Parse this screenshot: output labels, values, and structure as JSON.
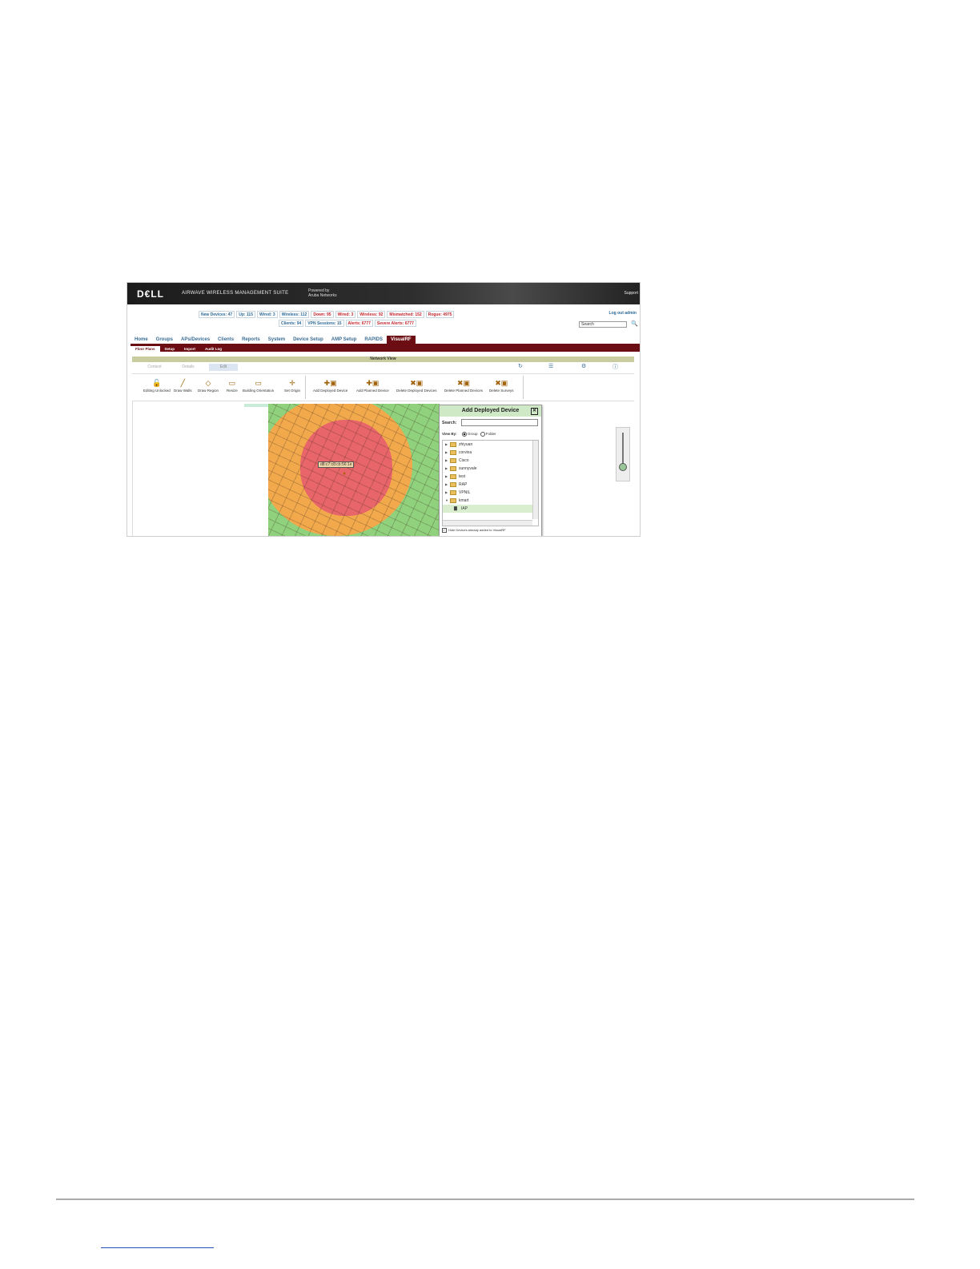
{
  "header": {
    "logo": "D€LL",
    "suite": "AIRWAVE WIRELESS MANAGEMENT SUITE",
    "powered_by": "Powered by",
    "powered_name": "Aruba Networks",
    "support": "Support"
  },
  "status_row1": [
    {
      "label": "New Devices: 47",
      "color": "blue"
    },
    {
      "label": "Up: 115",
      "color": "blue"
    },
    {
      "label": "Wired: 3",
      "color": "blue"
    },
    {
      "label": "Wireless: 112",
      "color": "blue"
    },
    {
      "label": "Down: 95",
      "color": "red"
    },
    {
      "label": "Wired: 3",
      "color": "red"
    },
    {
      "label": "Wireless: 92",
      "color": "red"
    },
    {
      "label": "Mismatched: 152",
      "color": "red"
    },
    {
      "label": "Rogue: 4975",
      "color": "red"
    }
  ],
  "status_row2": [
    {
      "label": "Clients: 94",
      "color": "blue"
    },
    {
      "label": "VPN Sessions: 15",
      "color": "blue"
    },
    {
      "label": "Alerts: 6777",
      "color": "red"
    },
    {
      "label": "Severe Alerts: 6777",
      "color": "red"
    }
  ],
  "logout": "Log out admin",
  "search": {
    "value": "Search"
  },
  "nav": [
    "Home",
    "Groups",
    "APs/Devices",
    "Clients",
    "Reports",
    "System",
    "Device Setup",
    "AMP Setup",
    "RAPIDS",
    "VisualRF"
  ],
  "nav_active": "VisualRF",
  "subnav": [
    "Floor Plans",
    "Setup",
    "Import",
    "Audit Log"
  ],
  "network_view": {
    "title": "Network View",
    "modes": [
      "Context",
      "Details",
      "Edit"
    ]
  },
  "toolbar_left": [
    "Editing Unlocked",
    "Draw Walls",
    "Draw Region",
    "Resize",
    "Building Orientation",
    "Set Origin"
  ],
  "toolbar_right": [
    "Add Deployed Device",
    "Add Planned Device",
    "Delete Deployed Devices",
    "Delete Planned Devices",
    "Delete Surveys"
  ],
  "map": {
    "device_label": "d8:c7:c8:cb:56:1e"
  },
  "dialog": {
    "title": "Add Deployed Device",
    "search_label": "Search:",
    "view_by_label": "View By:",
    "view_by_options": [
      "Group",
      "Folder"
    ],
    "tree": [
      "zhiyuan",
      "corvina",
      "Cisco",
      "sunnyvale",
      "test",
      "RAP",
      "VPNIL",
      "kmart"
    ],
    "tree_child": "IAP",
    "hide_label": "Hide Devices already added to VisualRF"
  }
}
